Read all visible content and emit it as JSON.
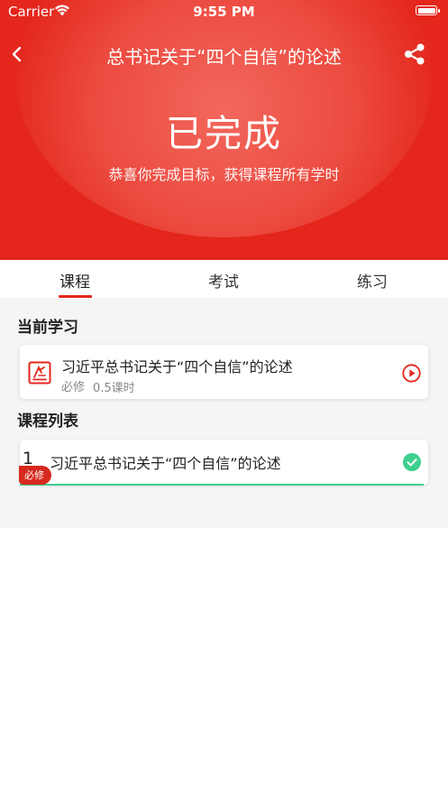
{
  "status_bar": {
    "carrier": "Carrier",
    "time": "9:55 PM"
  },
  "nav": {
    "title": "总书记关于“四个自信”的论述"
  },
  "hero": {
    "status": "已完成",
    "subtitle": "恭喜你完成目标，获得课程所有学时"
  },
  "tabs": [
    {
      "label": "课程",
      "active": true
    },
    {
      "label": "考试",
      "active": false
    },
    {
      "label": "练习",
      "active": false
    }
  ],
  "current": {
    "section_title": "当前学习",
    "course_name": "习近平总书记关于“四个自信”的论述",
    "type": "必修",
    "hours": "0.5课时"
  },
  "course_list": {
    "section_title": "课程列表",
    "items": [
      {
        "number": "1",
        "name": "习近平总书记关于“四个自信”的论述",
        "badge": "必修",
        "completed": true,
        "progress": 1.0
      }
    ]
  },
  "colors": {
    "brand_red": "#e4261c",
    "complete_green": "#3ecf8e"
  }
}
